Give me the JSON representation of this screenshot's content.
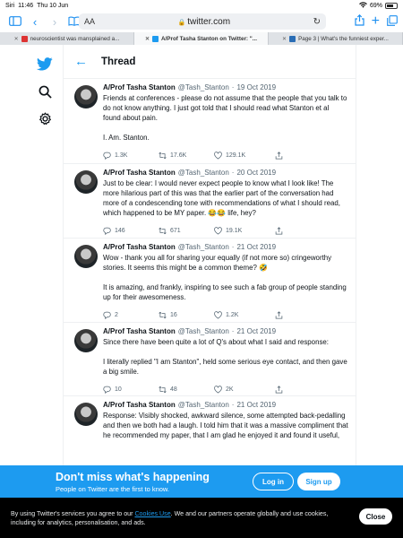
{
  "status": {
    "carrier": "Siri",
    "time": "11:46",
    "date": "Thu 10 Jun",
    "battery": "69%",
    "battery_level": 0.69
  },
  "browser": {
    "text_size": "AA",
    "url": "twitter.com"
  },
  "tabs": [
    {
      "label": "neuroscientist was mansplained a...",
      "active": false
    },
    {
      "label": "A/Prof Tasha Stanton on Twitter: \"...",
      "active": true
    },
    {
      "label": "Page 3 | What's the funniest exper...",
      "active": false
    }
  ],
  "thread": {
    "title": "Thread"
  },
  "tweets": [
    {
      "name": "A/Prof Tasha Stanton",
      "handle": "@Tash_Stanton",
      "date": "19 Oct 2019",
      "paragraphs": [
        "Friends at conferences - please do not assume that the people that you talk to do not know anything. I just got told that I should read what Stanton et al found about pain.",
        "I. Am. Stanton."
      ],
      "replies": "1.3K",
      "retweets": "17.6K",
      "likes": "129.1K"
    },
    {
      "name": "A/Prof Tasha Stanton",
      "handle": "@Tash_Stanton",
      "date": "20 Oct 2019",
      "paragraphs": [
        "Just to be clear: I would never expect people to know what I look like! The more hilarious part of this was that the earlier part of the conversation had more of a condescending tone with recommendations of what I should read, which happened to be MY paper. 😂😂 life, hey?"
      ],
      "replies": "146",
      "retweets": "671",
      "likes": "19.1K"
    },
    {
      "name": "A/Prof Tasha Stanton",
      "handle": "@Tash_Stanton",
      "date": "21 Oct 2019",
      "paragraphs": [
        "Wow - thank you all for sharing your equally (if not more so) cringeworthy stories. It seems this might be a common theme? 🤣",
        "It is amazing, and frankly, inspiring  to see such a fab group of people standing up for their awesomeness."
      ],
      "replies": "2",
      "retweets": "16",
      "likes": "1.2K"
    },
    {
      "name": "A/Prof Tasha Stanton",
      "handle": "@Tash_Stanton",
      "date": "21 Oct 2019",
      "paragraphs": [
        "Since there have been quite a lot of Q's about what I said and response:",
        "I literally replied \"I am Stanton\", held some serious eye contact, and then gave a big smile."
      ],
      "replies": "10",
      "retweets": "48",
      "likes": "2K"
    },
    {
      "name": "A/Prof Tasha Stanton",
      "handle": "@Tash_Stanton",
      "date": "21 Oct 2019",
      "paragraphs": [
        "Response: Visibly shocked, awkward silence, some attempted back-pedalling and then we both had a laugh. I told him that it was a massive compliment that he recommended my paper, that I am glad he enjoyed it and found it useful,"
      ],
      "replies": "",
      "retweets": "",
      "likes": ""
    }
  ],
  "banner": {
    "heading": "Don't miss what's happening",
    "subtext": "People on Twitter are the first to know.",
    "login": "Log in",
    "signup": "Sign up"
  },
  "cookie": {
    "text_before": "By using Twitter's services you agree to our ",
    "link": "Cookies Use",
    "text_after": ". We and our partners operate globally and use cookies, including for analytics, personalisation, and ads.",
    "close": "Close"
  },
  "colors": {
    "accent": "#1d9bf0",
    "text": "#0f1419",
    "muted": "#536471",
    "cookie_bg": "#000000"
  }
}
